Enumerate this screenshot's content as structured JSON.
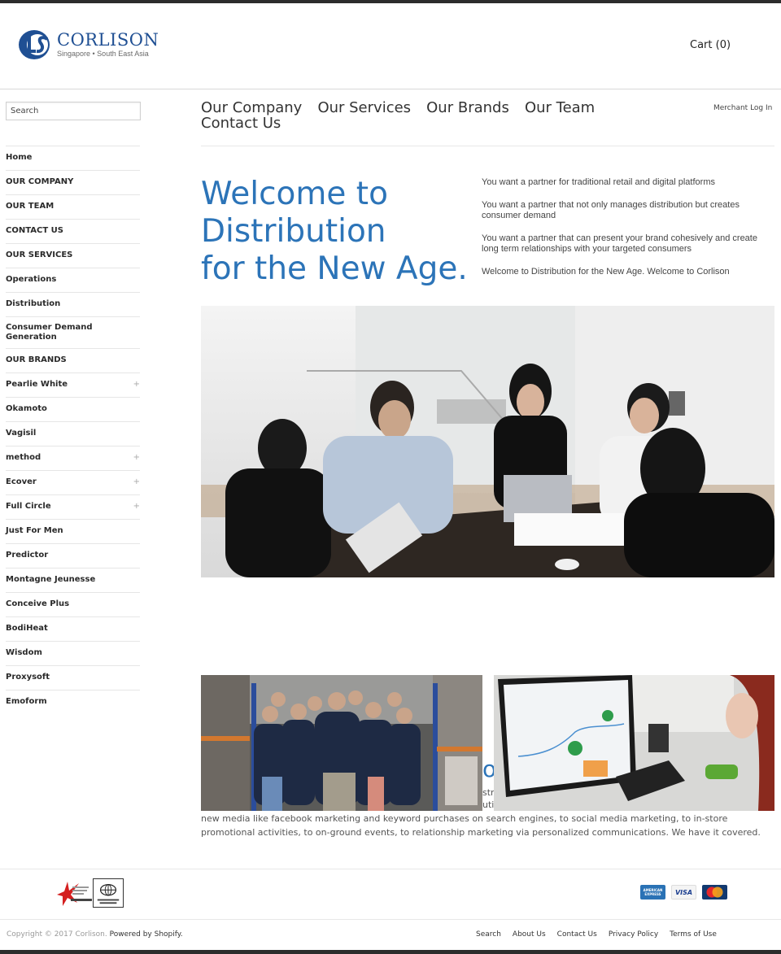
{
  "header": {
    "logo": {
      "name": "CORLISON",
      "tagline": "Singapore • South East Asia",
      "brand_color": "#1f4f93"
    },
    "cart_label": "Cart (0)"
  },
  "sidebar": {
    "search": {
      "placeholder": "Search",
      "value": ""
    },
    "items": [
      {
        "label": "Home",
        "expandable": false
      },
      {
        "label": "OUR COMPANY",
        "expandable": false
      },
      {
        "label": "OUR TEAM",
        "expandable": false
      },
      {
        "label": "CONTACT US",
        "expandable": false
      },
      {
        "label": "OUR SERVICES",
        "expandable": false
      },
      {
        "label": "Operations",
        "expandable": false
      },
      {
        "label": "Distribution",
        "expandable": false
      },
      {
        "label": "Consumer Demand Generation",
        "expandable": false
      },
      {
        "label": "OUR BRANDS",
        "expandable": false
      },
      {
        "label": "Pearlie White",
        "expandable": true
      },
      {
        "label": "Okamoto",
        "expandable": false
      },
      {
        "label": "Vagisil",
        "expandable": false
      },
      {
        "label": "method",
        "expandable": true
      },
      {
        "label": "Ecover",
        "expandable": true
      },
      {
        "label": "Full Circle",
        "expandable": true
      },
      {
        "label": "Just For Men",
        "expandable": false
      },
      {
        "label": "Predictor",
        "expandable": false
      },
      {
        "label": "Montagne Jeunesse",
        "expandable": false
      },
      {
        "label": "Conceive Plus",
        "expandable": false
      },
      {
        "label": "BodiHeat",
        "expandable": false
      },
      {
        "label": "Wisdom",
        "expandable": false
      },
      {
        "label": "Proxysoft",
        "expandable": false
      },
      {
        "label": "Emoform",
        "expandable": false
      }
    ],
    "expand_glyph": "+"
  },
  "main_nav": {
    "items": [
      "Our Company",
      "Our Services",
      "Our Brands",
      "Our Team",
      "Contact Us"
    ],
    "merchant_login": "Merchant Log In"
  },
  "hero": {
    "title_lines": [
      "Welcome to",
      "Distribution",
      "for the New Age."
    ],
    "accent_color": "#2c74b8",
    "paragraphs": [
      "You want a partner for traditional retail and digital platforms",
      "You want a partner that not only manages distribution but creates consumer demand",
      "You want a partner that can present your brand cohesively and create long term relationships with your targeted consumers",
      "Welcome to Distribution for the New Age. Welcome to Corlison"
    ]
  },
  "images": {
    "meeting": "Team meeting around a conference table with laptops",
    "warehouse": "Staff standing in a warehouse with arms crossed",
    "office": "Woman working at a computer showing analytics dashboard"
  },
  "content": {
    "obscured_heading_fragment": "ot",
    "obscured_lines": [
      "stro",
      "uti"
    ],
    "body_text": "new media like facebook marketing and keyword purchases on search engines, to social media marketing, to in-store promotional activities, to on-ground events, to relationship marketing via personalized communications. We have it covered."
  },
  "footer": {
    "certifications": [
      "SAC accredited certification body",
      "Certification International"
    ],
    "payment_methods": [
      "American Express",
      "VISA",
      "MasterCard"
    ],
    "copyright": "Copyright © 2017 Corlison.",
    "powered_by": "Powered by Shopify.",
    "links": [
      "Search",
      "About Us",
      "Contact Us",
      "Privacy Policy",
      "Terms of Use"
    ]
  }
}
